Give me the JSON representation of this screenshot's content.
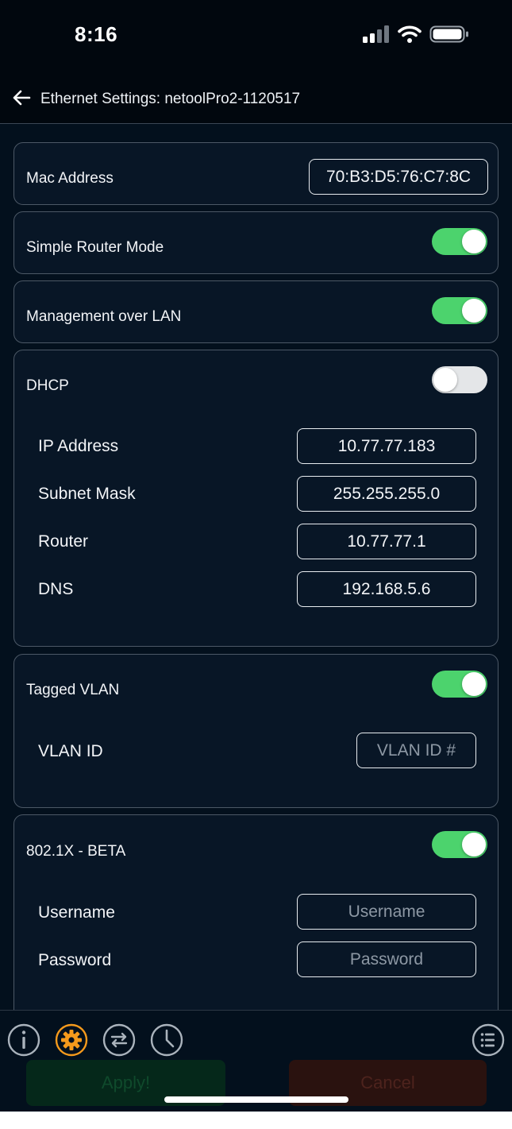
{
  "status_bar": {
    "time": "8:16"
  },
  "header": {
    "title": "Ethernet Settings: netoolPro2-1120517"
  },
  "mac": {
    "label": "Mac Address",
    "value": "70:B3:D5:76:C7:8C"
  },
  "simple_router": {
    "label": "Simple Router Mode",
    "enabled": true
  },
  "management_lan": {
    "label": "Management over LAN",
    "enabled": true
  },
  "dhcp": {
    "label": "DHCP",
    "enabled": false,
    "fields": [
      {
        "label": "IP Address",
        "value": "10.77.77.183"
      },
      {
        "label": "Subnet Mask",
        "value": "255.255.255.0"
      },
      {
        "label": "Router",
        "value": "10.77.77.1"
      },
      {
        "label": "DNS",
        "value": "192.168.5.6"
      }
    ]
  },
  "vlan": {
    "label": "Tagged VLAN",
    "enabled": true,
    "id_label": "VLAN ID",
    "id_placeholder": "VLAN ID #"
  },
  "dot1x": {
    "label": "802.1X - BETA",
    "enabled": true,
    "username_label": "Username",
    "username_placeholder": "Username",
    "password_label": "Password",
    "password_placeholder": "Password"
  },
  "tabs": [
    {
      "icon": "info-icon",
      "active": false
    },
    {
      "icon": "gear-icon",
      "active": true
    },
    {
      "icon": "swap-arrows-icon",
      "active": false
    },
    {
      "icon": "clock-icon",
      "active": false
    },
    {
      "icon": "list-icon",
      "active": false
    }
  ],
  "actions": {
    "apply_label": "Apply!",
    "cancel_label": "Cancel"
  },
  "colors": {
    "accent": "#f59a1c",
    "toggle_on": "#4cd36d",
    "background": "#03101d"
  }
}
